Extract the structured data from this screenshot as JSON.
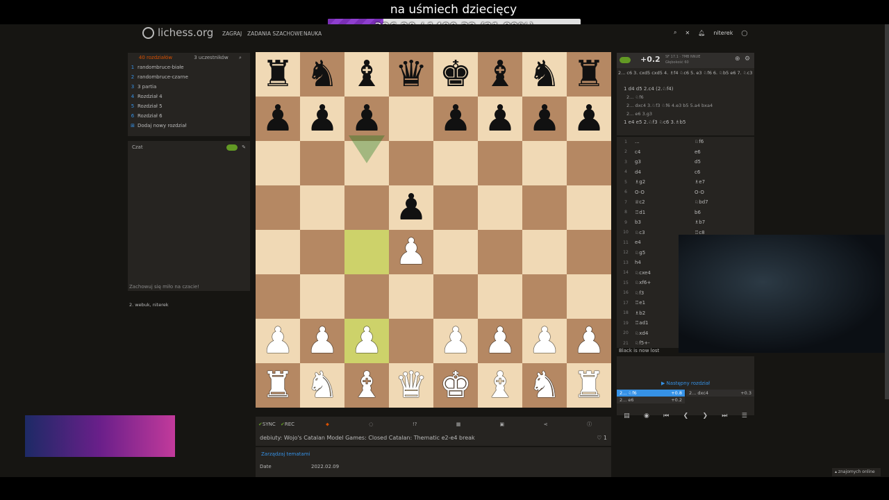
{
  "overlay": {
    "title": "na uśmiech dziecięcy",
    "progress_text": "326.20 / 1490.32 (21.89%)",
    "progress_fraction": 0.2189
  },
  "header": {
    "logo": "lichess.org",
    "nav": [
      "ZAGRAJ",
      "ZADANIA SZACHOWE",
      "NAUKA"
    ],
    "user": "niterek"
  },
  "study": {
    "tabs": [
      "40 rozdziałów",
      "3 uczestników"
    ],
    "chapters": [
      {
        "num": "1",
        "label": "randombruce-białe"
      },
      {
        "num": "2",
        "label": "randombruce-czarne"
      },
      {
        "num": "3",
        "label": "3 partia"
      },
      {
        "num": "4",
        "label": "Rozdział 4"
      },
      {
        "num": "5",
        "label": "Rozdział 5"
      },
      {
        "num": "6",
        "label": "Rozdział 6"
      }
    ],
    "add_chapter": "Dodaj nowy rozdział",
    "chat_label": "Czat",
    "chat_placeholder": "Zachowuj się miło na czacie!",
    "members": "2. webuk, niterek"
  },
  "board": {
    "rows": [
      [
        "♜",
        "♞",
        "♝",
        "♛",
        "♚",
        "♝",
        "♞",
        "♜"
      ],
      [
        "♟",
        "♟",
        "♟",
        "",
        "♟",
        "♟",
        "♟",
        "♟"
      ],
      [
        "",
        "",
        "",
        "",
        "",
        "",
        "",
        ""
      ],
      [
        "",
        "",
        "",
        "♟",
        "",
        "",
        "",
        ""
      ],
      [
        "",
        "",
        "",
        "♙",
        "",
        "",
        "",
        ""
      ],
      [
        "",
        "",
        "",
        "",
        "",
        "",
        "",
        ""
      ],
      [
        "♙",
        "♙",
        "♙",
        "",
        "♙",
        "♙",
        "♙",
        "♙"
      ],
      [
        "♖",
        "♘",
        "♗",
        "♕",
        "♔",
        "♗",
        "♘",
        "♖"
      ]
    ],
    "highlights": [
      "c4",
      "c2"
    ]
  },
  "tools": {
    "sync": "SYNC",
    "rec": "REC"
  },
  "chapter_title": "debiuty: Wojo's Catalan Model Games: Closed Catalan: Thematic e2-e4 break",
  "likes": "1",
  "manage_tags": "Zarządzaj tematami",
  "date_label": "Date",
  "date_value": "2022.02.09",
  "ceval": {
    "score": "+0.2",
    "engine": "SF 17.1 · 7MB NNUE",
    "depth": "Głębokość 60"
  },
  "pv_line": "2... c6 3. cxd5 cxd5 4. ♗f4 ♘c6 5. e3 ♘f6 6. ♘b5 e6 7. ♘c3",
  "analysis": {
    "l1": "1 d4 d5 2.c4 (2.♘f4)",
    "l2": "2... ♘f6",
    "l3": "2... dxc4 3.♘f3 ♘f6 4.e3 b5 5.a4 bxa4",
    "l4": "2... e6 3.g3",
    "l5": "1 e4 e5 2.♘f3 ♘c6 3.♗b5"
  },
  "move_list": [
    [
      "1",
      "...",
      "♘f6"
    ],
    [
      "2",
      "c4",
      "e6"
    ],
    [
      "3",
      "g3",
      "d5"
    ],
    [
      "4",
      "d4",
      "c6"
    ],
    [
      "5",
      "♗g2",
      "♗e7"
    ],
    [
      "6",
      "O-O",
      "O-O"
    ],
    [
      "7",
      "♕c2",
      "♘bd7"
    ],
    [
      "8",
      "♖d1",
      "b6"
    ],
    [
      "9",
      "b3",
      "♗b7"
    ],
    [
      "10",
      "♘c3",
      "♖c8"
    ],
    [
      "11",
      "e4",
      ""
    ],
    [
      "12",
      "♘g5",
      ""
    ],
    [
      "13",
      "h4",
      ""
    ],
    [
      "14",
      "♘cxe4",
      ""
    ],
    [
      "15",
      "♘xf6+",
      ""
    ],
    [
      "16",
      "♘f3",
      ""
    ],
    [
      "17",
      "♖e1",
      ""
    ],
    [
      "18",
      "♗b2",
      ""
    ],
    [
      "19",
      "♖ad1",
      ""
    ],
    [
      "20",
      "♘xd4",
      ""
    ],
    [
      "21",
      "♘f5+-",
      ""
    ]
  ],
  "status": "Black is now lost",
  "next_chapter": "Następny rozdział",
  "variations": [
    [
      "2... ♘f6",
      "+0.8",
      "2... dxc4",
      "+0.3"
    ],
    [
      "2... e6",
      "+0.2",
      "",
      ""
    ]
  ],
  "online": "znajomych online",
  "colors": {
    "accent": "#3692e7",
    "highlight": "#cdd26a",
    "purple": "#7a2fb6"
  }
}
